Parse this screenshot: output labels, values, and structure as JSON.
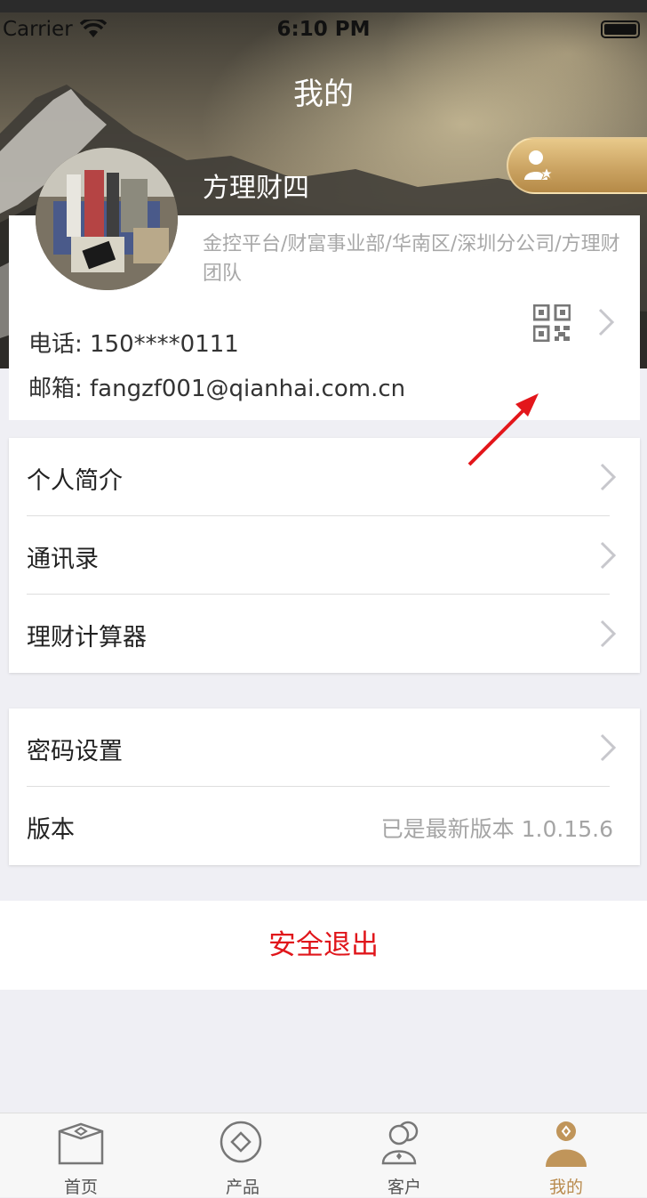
{
  "status_bar": {
    "carrier": "Carrier",
    "time": "6:10 PM"
  },
  "nav": {
    "title": "我的"
  },
  "profile": {
    "name": "方理财四",
    "org": "金控平台/财富事业部/华南区/深圳分公司/方理财团队",
    "phone": "电话: 150****0111",
    "email": "邮箱: fangzf001@qianhai.com.cn"
  },
  "menu_group1": [
    {
      "label": "个人简介"
    },
    {
      "label": "通讯录"
    },
    {
      "label": "理财计算器"
    }
  ],
  "menu_group2": {
    "password": "密码设置",
    "version_label": "版本",
    "version_value": "已是最新版本 1.0.15.6"
  },
  "logout": {
    "label": "安全退出"
  },
  "tabbar": {
    "tabs": [
      {
        "label": "首页"
      },
      {
        "label": "产品"
      },
      {
        "label": "客户"
      },
      {
        "label": "我的"
      }
    ]
  },
  "colors": {
    "accent": "#b98b4e",
    "logout": "#e0161b",
    "background": "#efeff4"
  }
}
